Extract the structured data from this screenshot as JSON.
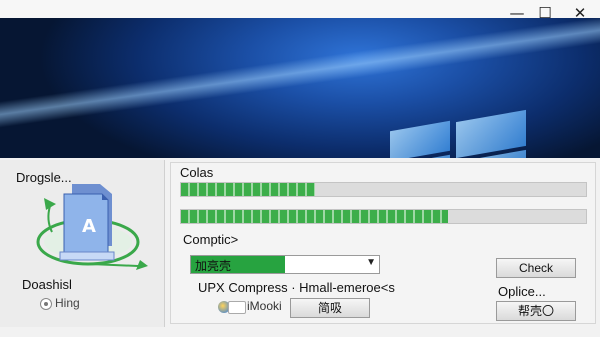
{
  "window": {
    "controls": [
      "—",
      "☐",
      "✕"
    ]
  },
  "left": {
    "title": "Drogsle...",
    "label_bottom": "Doashisl",
    "radio_label": "Hing",
    "icon_letter": "A"
  },
  "right": {
    "progress_label": "Colas",
    "progress": [
      {
        "fill": 0.33
      },
      {
        "fill": 0.66
      }
    ],
    "compress_label": "Comptic>",
    "dropdown_value": "加亮壳",
    "upx_label": "UPX Compress · Hmall-emeroe<s",
    "option_label": "Oplice...",
    "check_label": "iMooki",
    "buttons": {
      "check": "Check",
      "mid": "简吸",
      "bottom": "帮壳〇"
    }
  },
  "colors": {
    "accent_green": "#27a340",
    "wallpaper_blue": "#1b4fa6"
  }
}
